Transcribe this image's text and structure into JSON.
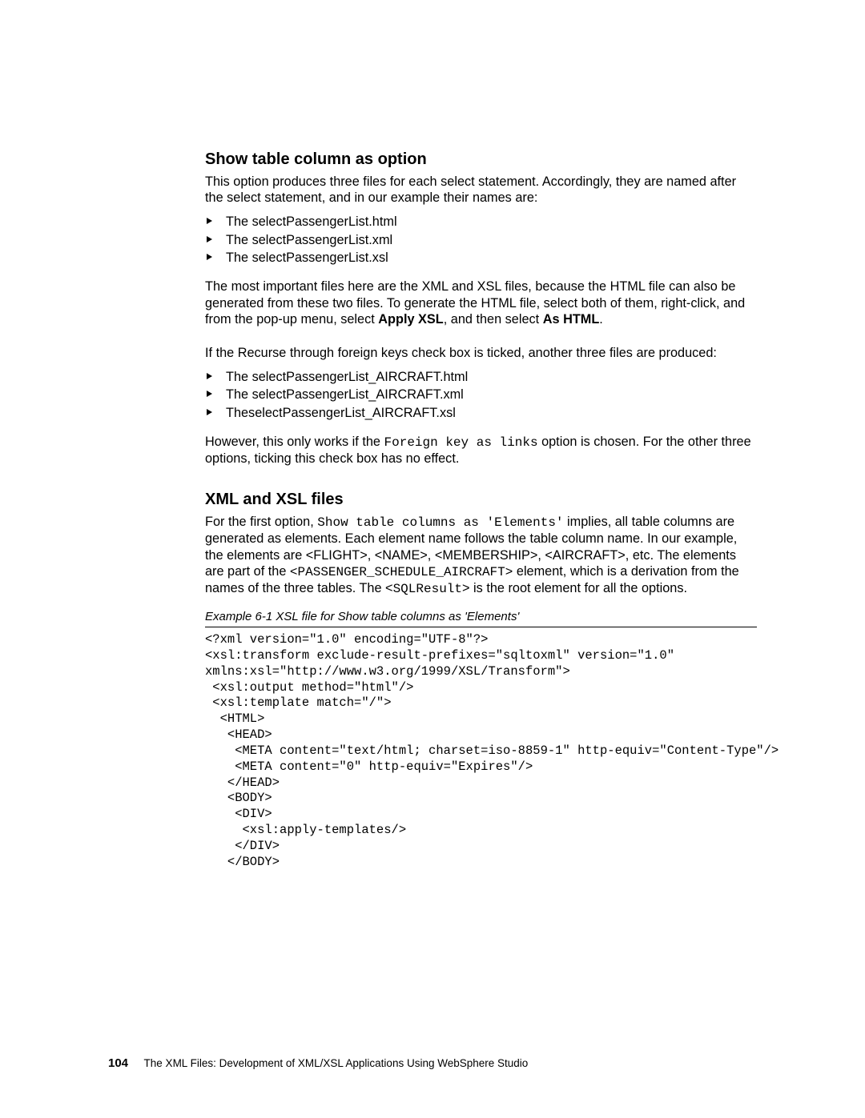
{
  "section1": {
    "heading": "Show table column as option",
    "p1": "This option produces three files for each select statement. Accordingly, they are named after the select statement, and in our example their names are:",
    "list1": [
      "The selectPassengerList.html",
      "The selectPassengerList.xml",
      "The selectPassengerList.xsl"
    ],
    "p2a": "The most important files here are the XML and XSL files, because the HTML file can also be generated from these two files. To generate the HTML file, select both of them, right-click, and from the pop-up menu, select ",
    "p2b": "Apply XSL",
    "p2c": ", and then select ",
    "p2d": "As HTML",
    "p2e": ".",
    "p3": "If the Recurse through foreign keys check box is ticked, another three files are produced:",
    "list2": [
      "The selectPassengerList_AIRCRAFT.html",
      "The selectPassengerList_AIRCRAFT.xml",
      "TheselectPassengerList_AIRCRAFT.xsl"
    ],
    "p4a": "However, this only works if the ",
    "p4b": "Foreign key as links",
    "p4c": " option is chosen. For the other three options, ticking this check box has no effect."
  },
  "section2": {
    "heading": "XML and XSL files",
    "p1a": "For the first option, ",
    "p1b": "Show table columns as 'Elements'",
    "p1c": " implies, all table columns are generated as elements. Each element name follows the table column name. In our example, the elements are <FLIGHT>, <NAME>, <MEMBERSHIP>, <AIRCRAFT>, etc. The elements are part of the ",
    "p1d": "<PASSENGER_SCHEDULE_AIRCRAFT>",
    "p1e": " element, which is a derivation from the names of the three tables. The <",
    "p1f": "SQLResult",
    "p1g": "> is the root element for all the options.",
    "caption": "Example 6-1   XSL file for Show table columns as 'Elements'",
    "code": "<?xml version=\"1.0\" encoding=\"UTF-8\"?>\n<xsl:transform exclude-result-prefixes=\"sqltoxml\" version=\"1.0\" \nxmlns:xsl=\"http://www.w3.org/1999/XSL/Transform\">\n <xsl:output method=\"html\"/>\n <xsl:template match=\"/\">\n  <HTML>\n   <HEAD>\n    <META content=\"text/html; charset=iso-8859-1\" http-equiv=\"Content-Type\"/>\n    <META content=\"0\" http-equiv=\"Expires\"/>\n   </HEAD>\n   <BODY>\n    <DIV>\n     <xsl:apply-templates/>\n    </DIV>\n   </BODY>"
  },
  "footer": {
    "page": "104",
    "text": "The XML Files:  Development of XML/XSL Applications Using WebSphere Studio"
  }
}
